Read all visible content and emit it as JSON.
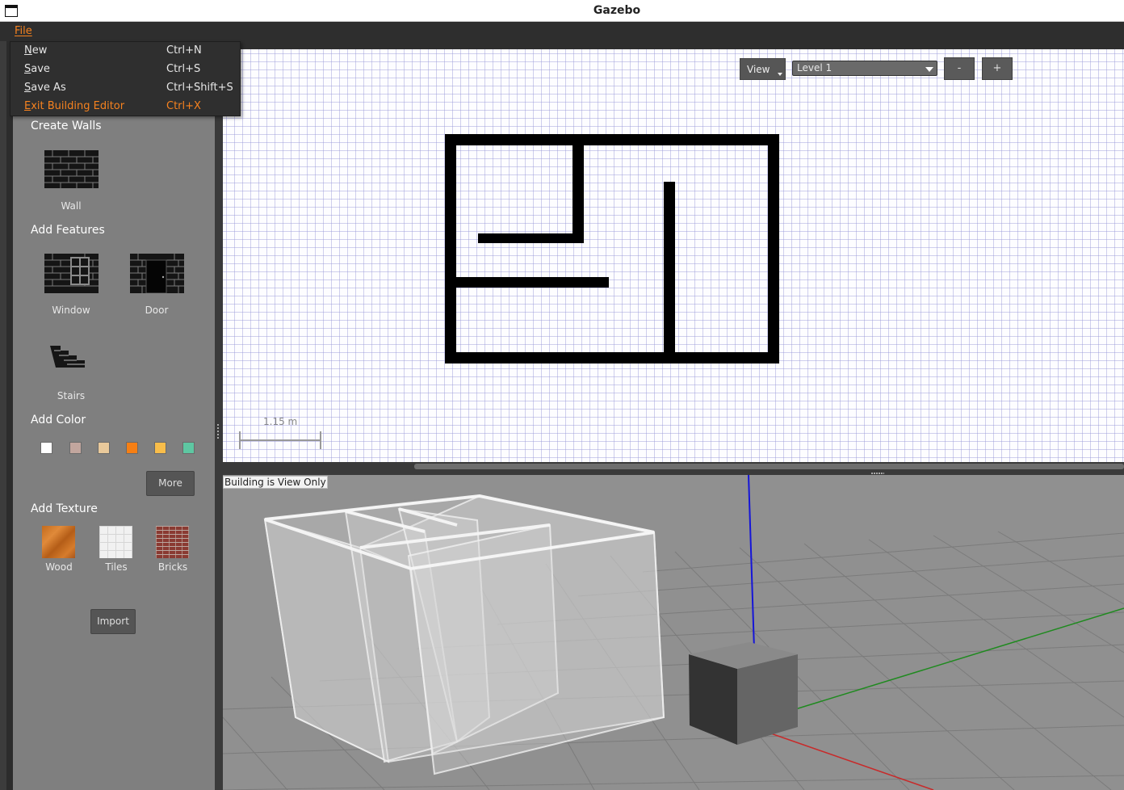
{
  "window": {
    "title": "Gazebo"
  },
  "menubar": {
    "file_label": "File"
  },
  "file_menu": {
    "items": [
      {
        "label_mnemonic": "N",
        "label_rest": "ew",
        "shortcut": "Ctrl+N"
      },
      {
        "label_mnemonic": "S",
        "label_rest": "ave",
        "shortcut": "Ctrl+S"
      },
      {
        "label_mnemonic": "S",
        "label_rest": "ave As",
        "shortcut": "Ctrl+Shift+S"
      },
      {
        "label_mnemonic": "E",
        "label_rest": "xit Building Editor",
        "shortcut": "Ctrl+X"
      }
    ]
  },
  "palette": {
    "create_walls_title": "Create Walls",
    "wall_label": "Wall",
    "add_features_title": "Add Features",
    "window_label": "Window",
    "door_label": "Door",
    "stairs_label": "Stairs",
    "add_color_title": "Add Color",
    "colors": [
      "#ffffff",
      "#c2a69e",
      "#e9c99b",
      "#f67f14",
      "#f8bd4a",
      "#5ec7a2"
    ],
    "more_button": "More",
    "add_texture_title": "Add Texture",
    "textures": [
      "Wood",
      "Tiles",
      "Bricks"
    ],
    "import_button": "Import"
  },
  "editor2d": {
    "view_button": "View",
    "level_select": "Level 1",
    "level_minus": "-",
    "level_plus": "+",
    "scale_label": "1.15 m"
  },
  "view3d": {
    "status_label": "Building is View Only"
  }
}
